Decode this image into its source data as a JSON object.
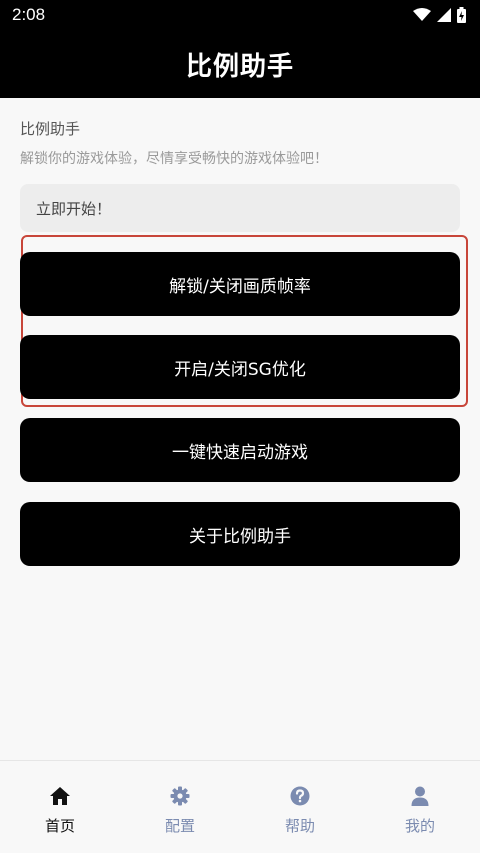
{
  "status_bar": {
    "time": "2:08"
  },
  "header": {
    "title": "比例助手"
  },
  "main": {
    "section_title": "比例助手",
    "section_subtitle": "解锁你的游戏体验，尽情享受畅快的游戏体验吧！",
    "start_text": "立即开始！",
    "buttons": [
      {
        "label": "解锁/关闭画质帧率"
      },
      {
        "label": "开启/关闭SG优化"
      },
      {
        "label": "一键快速启动游戏"
      },
      {
        "label": "关于比例助手"
      }
    ],
    "highlight_color": "#c8463a"
  },
  "tabs": [
    {
      "label": "首页",
      "icon": "home-icon",
      "active": true
    },
    {
      "label": "配置",
      "icon": "gear-icon",
      "active": false
    },
    {
      "label": "帮助",
      "icon": "help-icon",
      "active": false
    },
    {
      "label": "我的",
      "icon": "user-icon",
      "active": false
    }
  ],
  "colors": {
    "active_tab": "#111111",
    "inactive_tab": "#7b8bb0",
    "button_bg": "#000000"
  }
}
